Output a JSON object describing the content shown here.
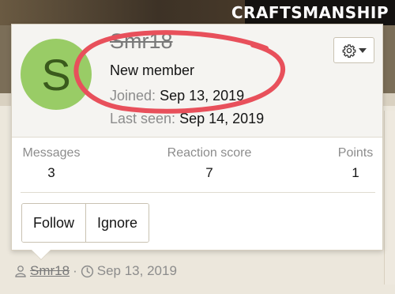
{
  "banner": {
    "title": "CRAFTSMANSHIP"
  },
  "profile": {
    "avatar_letter": "S",
    "avatar_color": "#99cc66",
    "username": "Smr18",
    "user_title": "New member",
    "joined_label": "Joined:",
    "joined_value": "Sep 13, 2019",
    "last_seen_label": "Last seen:",
    "last_seen_value": "Sep 14, 2019",
    "menu_icon": "gear-icon"
  },
  "stats": [
    {
      "label": "Messages",
      "value": "3"
    },
    {
      "label": "Reaction score",
      "value": "7"
    },
    {
      "label": "Points",
      "value": "1"
    }
  ],
  "actions": {
    "follow": "Follow",
    "ignore": "Ignore"
  },
  "byline": {
    "author": "Smr18",
    "date": "Sep 13, 2019",
    "author_icon": "user-icon",
    "date_icon": "clock-icon"
  },
  "annotation_color": "#e8505b"
}
